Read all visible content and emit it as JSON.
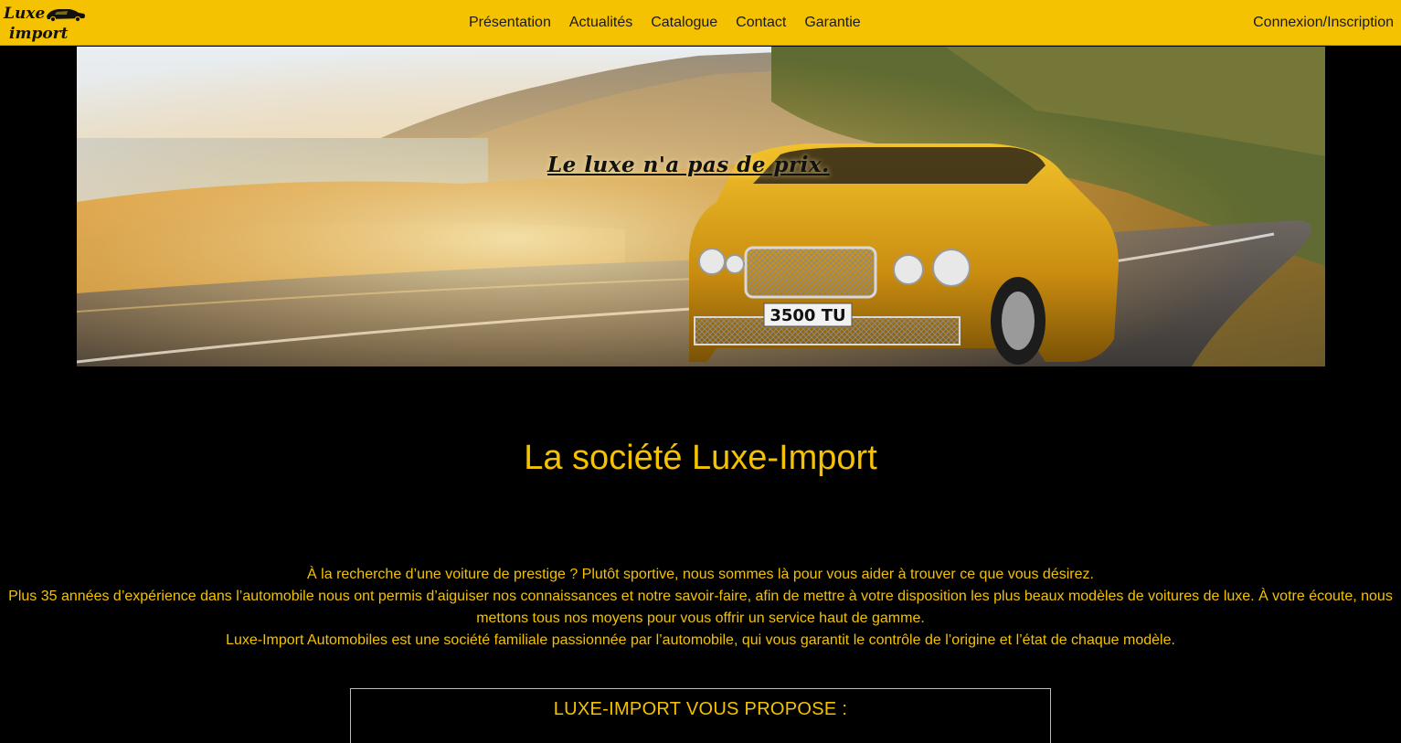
{
  "brand": {
    "logo_line1": "Luxe",
    "logo_line2": "import",
    "primary_color": "#f4c200"
  },
  "nav": {
    "items": [
      {
        "label": "Présentation"
      },
      {
        "label": "Actualités"
      },
      {
        "label": "Catalogue"
      },
      {
        "label": "Contact"
      },
      {
        "label": "Garantie"
      }
    ],
    "login_label": "Connexion/Inscription"
  },
  "hero": {
    "slogan": "Le luxe n'a pas de prix.",
    "plate": "3500 TU"
  },
  "main": {
    "title": "La société Luxe-Import",
    "paragraphs": [
      "À la recherche d’une voiture de prestige ? Plutôt sportive, nous sommes là pour vous aider à trouver ce que vous désirez.",
      "Plus 35 années d’expérience dans l’automobile nous ont permis d’aiguiser nos connaissances et notre savoir-faire, afin de mettre à votre disposition les plus beaux modèles de voitures de luxe. À votre écoute, nous mettons tous nos moyens pour vous offrir un service haut de gamme.",
      "Luxe-Import Automobiles est une société familiale passionnée par l’automobile, qui vous garantit le contrôle de l’origine et l’état de chaque modèle."
    ],
    "offer_title": "LUXE-IMPORT VOUS PROPOSE :"
  }
}
